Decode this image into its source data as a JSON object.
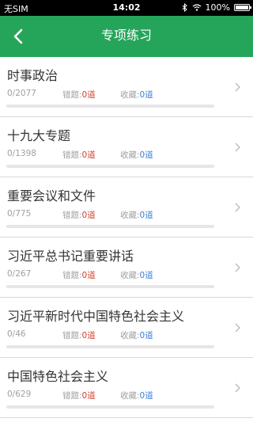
{
  "status_bar": {
    "carrier": "无SIM",
    "time": "14:02",
    "battery_text": "100%",
    "battery_level": 1.0
  },
  "header": {
    "title": "专项练习",
    "back_icon": "chevron-left-icon"
  },
  "colors": {
    "header_green": "#25a55a",
    "wrong_red": "#d0402c",
    "fav_blue": "#3a7fd5"
  },
  "labels": {
    "wrong": "错题:",
    "favorites": "收藏:"
  },
  "items": [
    {
      "title": "时事政治",
      "progress": "0/2077",
      "wrong": "0道",
      "favorites": "0道",
      "completion": 0
    },
    {
      "title": "十九大专题",
      "progress": "0/1398",
      "wrong": "0道",
      "favorites": "0道",
      "completion": 0
    },
    {
      "title": "重要会议和文件",
      "progress": "0/775",
      "wrong": "0道",
      "favorites": "0道",
      "completion": 0
    },
    {
      "title": "习近平总书记重要讲话",
      "progress": "0/267",
      "wrong": "0道",
      "favorites": "0道",
      "completion": 0
    },
    {
      "title": "习近平新时代中国特色社会主义",
      "progress": "0/46",
      "wrong": "0道",
      "favorites": "0道",
      "completion": 0
    },
    {
      "title": "中国特色社会主义",
      "progress": "0/629",
      "wrong": "0道",
      "favorites": "0道",
      "completion": 0
    }
  ]
}
